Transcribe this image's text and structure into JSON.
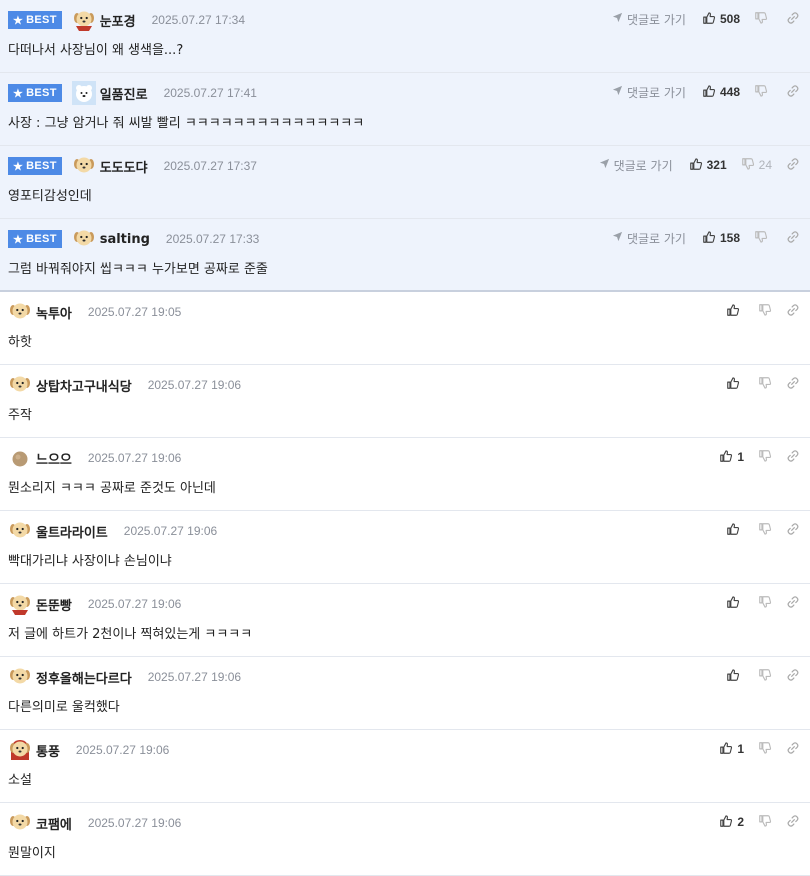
{
  "best_label": "BEST",
  "reply_label": "댓글로 가기",
  "best_comments": [
    {
      "nick": "눈포경",
      "date": "2025.07.27 17:34",
      "text": "다떠나서 사장님이 왜 생색을...?",
      "likes": "508",
      "dislikes": "",
      "avatar": "dog-red-scarf"
    },
    {
      "nick": "일품진로",
      "date": "2025.07.27 17:41",
      "text": "사장 : 그냥 암거나 줘 씨발 빨리 ㅋㅋㅋㅋㅋㅋㅋㅋㅋㅋㅋㅋㅋㅋㅋ",
      "likes": "448",
      "dislikes": "",
      "avatar": "polar-bear"
    },
    {
      "nick": "도도도댜",
      "date": "2025.07.27 17:37",
      "text": "영포티감성인데",
      "likes": "321",
      "dislikes": "24",
      "avatar": "dog-face"
    },
    {
      "nick": "salting",
      "date": "2025.07.27 17:33",
      "text": "그럼 바꿔줘야지 씹ㅋㅋㅋ 누가보면 공짜로 준줄",
      "likes": "158",
      "dislikes": "",
      "avatar": "dog-face"
    }
  ],
  "comments": [
    {
      "nick": "녹투아",
      "date": "2025.07.27 19:05",
      "text": "하핫",
      "likes": "",
      "avatar": "dog-puppy"
    },
    {
      "nick": "상탑차고구내식당",
      "date": "2025.07.27 19:06",
      "text": "주작",
      "likes": "",
      "avatar": "dog-puppy"
    },
    {
      "nick": "느으으",
      "date": "2025.07.27 19:06",
      "text": "뭔소리지 ㅋㅋㅋ 공짜로 준것도 아닌데",
      "likes": "1",
      "avatar": "ball"
    },
    {
      "nick": "울트라라이트",
      "date": "2025.07.27 19:06",
      "text": "빡대가리냐 사장이냐 손님이냐",
      "likes": "",
      "avatar": "dog-puppy"
    },
    {
      "nick": "돈뚠빵",
      "date": "2025.07.27 19:06",
      "text": "저 글에 하트가 2천이나 찍혀있는게 ㅋㅋㅋㅋ",
      "likes": "",
      "avatar": "dog-red-scarf"
    },
    {
      "nick": "정후올해는다르다",
      "date": "2025.07.27 19:06",
      "text": "다른의미로 울컥했다",
      "likes": "",
      "avatar": "dog-face"
    },
    {
      "nick": "통풍",
      "date": "2025.07.27 19:06",
      "text": "소설",
      "likes": "1",
      "avatar": "dog-red-hood"
    },
    {
      "nick": "코팸에",
      "date": "2025.07.27 19:06",
      "text": "뭔말이지",
      "likes": "2",
      "avatar": "dog-puppy"
    }
  ],
  "colors": {
    "best_badge": "#4d8ae6",
    "best_bg": "#eef3fc",
    "divider": "#e3e7ee"
  }
}
